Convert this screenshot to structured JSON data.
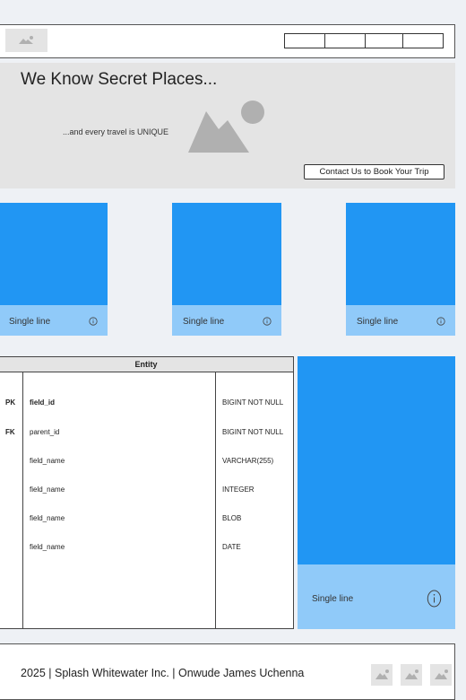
{
  "header": {
    "logo_icon": "image-icon",
    "nav_items": [
      "",
      "",
      "",
      ""
    ]
  },
  "hero": {
    "title": "We Know Secret Places...",
    "subtitle": "...and every travel is UNIQUE",
    "image_icon": "image-icon",
    "cta_label": "Contact Us to Book Your Trip"
  },
  "tiles": [
    {
      "caption": "Single line",
      "icon": "info-icon"
    },
    {
      "caption": "Single line",
      "icon": "info-icon"
    },
    {
      "caption": "Single line",
      "icon": "info-icon"
    }
  ],
  "entity": {
    "title": "Entity",
    "keys": [
      "PK",
      "FK"
    ],
    "fields": [
      "field_id",
      "parent_id",
      "field_name",
      "field_name",
      "field_name",
      "field_name"
    ],
    "types": [
      "BIGINT NOT NULL",
      "BIGINT NOT NULL",
      "VARCHAR(255)",
      "INTEGER",
      "BLOB",
      "DATE"
    ]
  },
  "side_tile": {
    "caption": "Single line",
    "icon": "info-icon"
  },
  "footer": {
    "text": "2025 | Splash Whitewater Inc. | Onwude James Uchenna",
    "icons": [
      "image-icon",
      "image-icon",
      "image-icon"
    ]
  },
  "colors": {
    "tile_blue": "#2196f3",
    "caption_blue": "#90caf9",
    "placeholder_gray": "#e4e4e4",
    "icon_gray": "#b0b0b0"
  }
}
